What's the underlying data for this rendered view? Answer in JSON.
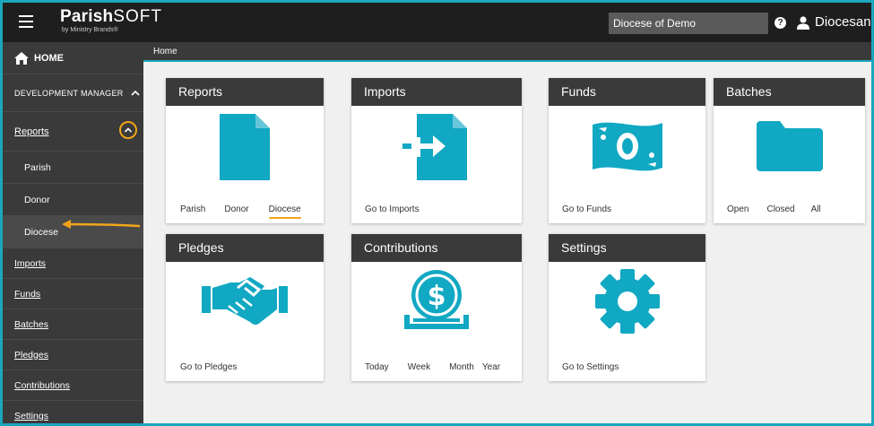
{
  "app": {
    "logo_main": "Parish",
    "logo_soft": "SOFT",
    "logo_sub": "by Ministry Brands®",
    "diocese_select_value": "Diocese of Demo",
    "help_label": "?",
    "user_name": "Diocesan"
  },
  "sidebar": {
    "home": "HOME",
    "section": "DEVELOPMENT MANAGER",
    "reports": "Reports",
    "sub_items": [
      "Parish",
      "Donor",
      "Diocese"
    ],
    "items": [
      "Imports",
      "Funds",
      "Batches",
      "Pledges",
      "Contributions",
      "Settings"
    ]
  },
  "breadcrumb": "Home",
  "cards": {
    "reports": {
      "title": "Reports",
      "links": [
        "Parish",
        "Donor",
        "Diocese"
      ]
    },
    "imports": {
      "title": "Imports",
      "links": [
        "Go to Imports"
      ]
    },
    "funds": {
      "title": "Funds",
      "links": [
        "Go to Funds"
      ]
    },
    "batches": {
      "title": "Batches",
      "links": [
        "Open",
        "Closed",
        "All"
      ]
    },
    "pledges": {
      "title": "Pledges",
      "links": [
        "Go to Pledges"
      ]
    },
    "contributions": {
      "title": "Contributions",
      "links": [
        "Today",
        "Week",
        "Month",
        "Year"
      ]
    },
    "settings": {
      "title": "Settings",
      "links": [
        "Go to Settings"
      ]
    }
  },
  "colors": {
    "accent": "#1aa6bd",
    "icon": "#11a8c3",
    "annotation": "#f2a51a",
    "header_bg": "#3a3a3a"
  }
}
